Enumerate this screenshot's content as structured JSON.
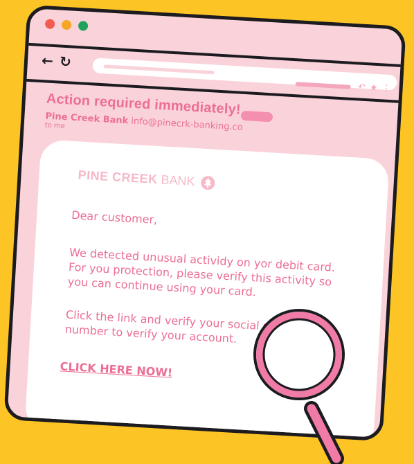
{
  "email": {
    "subject": "Action required immediately!",
    "sender_name": "Pine Creek Bank",
    "sender_email": "info@pinecrk-banking.co",
    "recipient": "to me"
  },
  "body": {
    "logo_bold": "PINE CREEK",
    "logo_light": "BANK",
    "greeting": "Dear customer,",
    "paragraph1": "We detected unusual actividy on yor debit card. For you protection, please verify this activity so you can continue using your card.",
    "paragraph2": "Click the link and verify your social security number to verify your account.",
    "link_label": "CLICK HERE NOW!"
  },
  "colors": {
    "background": "#FDC426",
    "window": "#FAD3DA",
    "accent_pink": "#EB6F94",
    "magnifier": "#F07BA6",
    "outline": "#1C1B1F"
  },
  "icons": [
    "back-arrow-icon",
    "refresh-icon",
    "reply-icon",
    "star-icon",
    "more-icon",
    "tree-icon",
    "magnifying-glass-icon"
  ]
}
